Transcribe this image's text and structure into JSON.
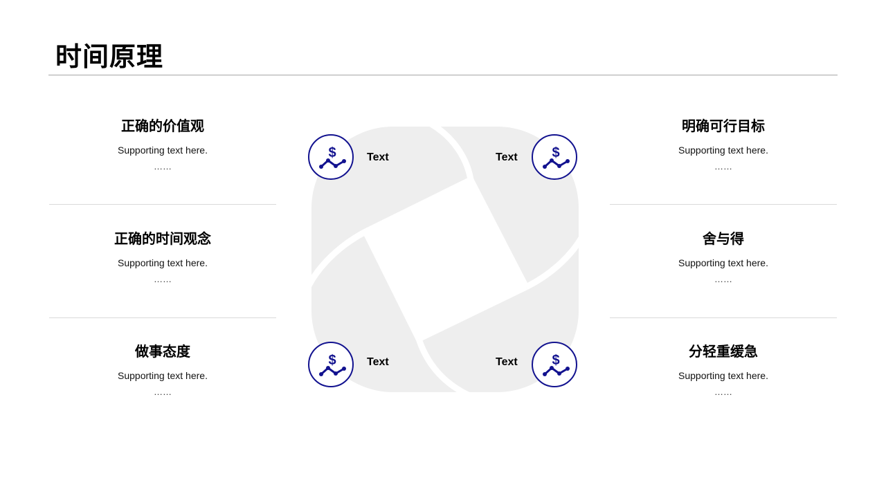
{
  "page": {
    "title": "时间原理"
  },
  "left_items": [
    {
      "title": "正确的价值观",
      "text": "Supporting  text here.",
      "dots": "……"
    },
    {
      "title": "正确的时间观念",
      "text": "Supporting  text here.",
      "dots": "……"
    },
    {
      "title": "做事态度",
      "text": "Supporting  text here.",
      "dots": "……"
    }
  ],
  "right_items": [
    {
      "title": "明确可行目标",
      "text": "Supporting  text here.",
      "dots": "……"
    },
    {
      "title": "舍与得",
      "text": "Supporting  text here.",
      "dots": "……"
    },
    {
      "title": "分轻重缓急",
      "text": "Supporting  text here.",
      "dots": "……"
    }
  ],
  "center": {
    "labels": [
      "Text",
      "Text",
      "Text",
      "Text"
    ],
    "icon": "dollar-trend-icon",
    "icon_symbol": "$"
  },
  "colors": {
    "accent": "#12128f",
    "shape_fill": "#eeeeee",
    "rule": "#a6a6a6",
    "separator": "#d9d9d9"
  }
}
